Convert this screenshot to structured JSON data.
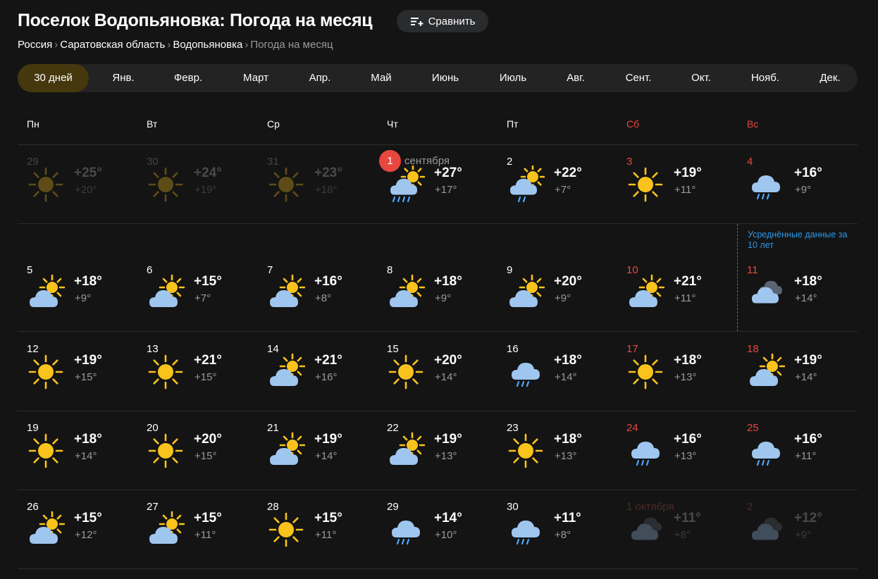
{
  "header": {
    "title": "Поселок Водопьяновка: Погода на месяц",
    "compare_label": "Сравнить"
  },
  "breadcrumbs": [
    "Россия",
    "Саратовская область",
    "Водопьяновка",
    "Погода на месяц"
  ],
  "tabs": [
    "30 дней",
    "Янв.",
    "Февр.",
    "Март",
    "Апр.",
    "Май",
    "Июнь",
    "Июль",
    "Авг.",
    "Сент.",
    "Окт.",
    "Нояб.",
    "Дек."
  ],
  "active_tab": "30 дней",
  "weekdays": [
    "Пн",
    "Вт",
    "Ср",
    "Чт",
    "Пт",
    "Сб",
    "Вс"
  ],
  "today": {
    "badge": "1",
    "month": "сентября"
  },
  "averaged_note": "Усреднённые данные за 10 лет",
  "colors": {
    "accent_red": "#e8473f",
    "sun": "#f9c31c",
    "cloud": "#9fc6ef",
    "rain": "#4da6ff",
    "note_blue": "#2a96e8"
  },
  "weeks": [
    [
      {
        "day": "29",
        "icon": "sun-icon",
        "hi": "+25°",
        "lo": "+20°",
        "dim": true
      },
      {
        "day": "30",
        "icon": "sun-icon",
        "hi": "+24°",
        "lo": "+19°",
        "dim": true
      },
      {
        "day": "31",
        "icon": "sun-icon",
        "hi": "+23°",
        "lo": "+18°",
        "dim": true
      },
      {
        "day": "",
        "icon": "partly-cloudy-rain-icon",
        "hi": "+27°",
        "lo": "+17°"
      },
      {
        "day": "2",
        "icon": "partly-cloudy-light-rain-icon",
        "hi": "+22°",
        "lo": "+7°"
      },
      {
        "day": "3",
        "icon": "sun-icon",
        "hi": "+19°",
        "lo": "+11°"
      },
      {
        "day": "4",
        "icon": "rain-cloud-icon",
        "hi": "+16°",
        "lo": "+9°"
      }
    ],
    [
      {
        "day": "5",
        "icon": "partly-cloudy-icon",
        "hi": "+18°",
        "lo": "+9°"
      },
      {
        "day": "6",
        "icon": "partly-cloudy-icon",
        "hi": "+15°",
        "lo": "+7°"
      },
      {
        "day": "7",
        "icon": "partly-cloudy-icon",
        "hi": "+16°",
        "lo": "+8°"
      },
      {
        "day": "8",
        "icon": "partly-cloudy-icon",
        "hi": "+18°",
        "lo": "+9°"
      },
      {
        "day": "9",
        "icon": "partly-cloudy-icon",
        "hi": "+20°",
        "lo": "+9°"
      },
      {
        "day": "10",
        "icon": "partly-cloudy-icon",
        "hi": "+21°",
        "lo": "+11°"
      },
      {
        "day": "11",
        "icon": "cloudy-icon",
        "hi": "+18°",
        "lo": "+14°"
      }
    ],
    [
      {
        "day": "12",
        "icon": "sun-icon",
        "hi": "+19°",
        "lo": "+15°"
      },
      {
        "day": "13",
        "icon": "sun-icon",
        "hi": "+21°",
        "lo": "+15°"
      },
      {
        "day": "14",
        "icon": "partly-cloudy-icon",
        "hi": "+21°",
        "lo": "+16°"
      },
      {
        "day": "15",
        "icon": "sun-icon",
        "hi": "+20°",
        "lo": "+14°"
      },
      {
        "day": "16",
        "icon": "rain-cloud-icon",
        "hi": "+18°",
        "lo": "+14°"
      },
      {
        "day": "17",
        "icon": "sun-icon",
        "hi": "+18°",
        "lo": "+13°"
      },
      {
        "day": "18",
        "icon": "partly-cloudy-icon",
        "hi": "+19°",
        "lo": "+14°"
      }
    ],
    [
      {
        "day": "19",
        "icon": "sun-icon",
        "hi": "+18°",
        "lo": "+14°"
      },
      {
        "day": "20",
        "icon": "sun-icon",
        "hi": "+20°",
        "lo": "+15°"
      },
      {
        "day": "21",
        "icon": "partly-cloudy-icon",
        "hi": "+19°",
        "lo": "+14°"
      },
      {
        "day": "22",
        "icon": "partly-cloudy-icon",
        "hi": "+19°",
        "lo": "+13°"
      },
      {
        "day": "23",
        "icon": "sun-icon",
        "hi": "+18°",
        "lo": "+13°"
      },
      {
        "day": "24",
        "icon": "rain-cloud-icon",
        "hi": "+16°",
        "lo": "+13°"
      },
      {
        "day": "25",
        "icon": "rain-cloud-icon",
        "hi": "+16°",
        "lo": "+11°"
      }
    ],
    [
      {
        "day": "26",
        "icon": "partly-cloudy-icon",
        "hi": "+15°",
        "lo": "+12°"
      },
      {
        "day": "27",
        "icon": "partly-cloudy-icon",
        "hi": "+15°",
        "lo": "+11°"
      },
      {
        "day": "28",
        "icon": "sun-icon",
        "hi": "+15°",
        "lo": "+11°"
      },
      {
        "day": "29",
        "icon": "rain-cloud-icon",
        "hi": "+14°",
        "lo": "+10°"
      },
      {
        "day": "30",
        "icon": "rain-cloud-icon",
        "hi": "+11°",
        "lo": "+8°"
      },
      {
        "day": "1 октября",
        "icon": "cloudy-icon",
        "hi": "+11°",
        "lo": "+8°",
        "dim": true
      },
      {
        "day": "2",
        "icon": "cloudy-icon",
        "hi": "+12°",
        "lo": "+9°",
        "dim": true
      }
    ]
  ]
}
